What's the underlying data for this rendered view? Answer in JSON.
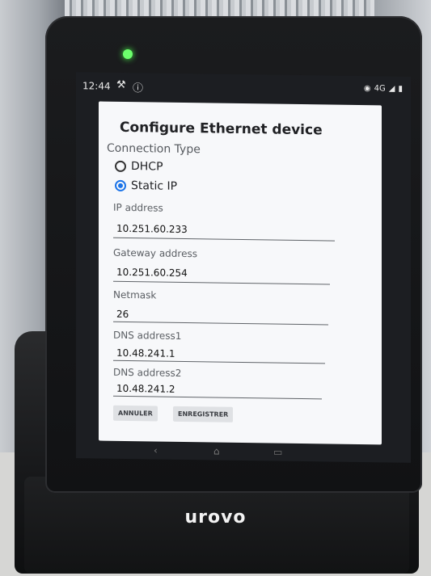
{
  "statusbar": {
    "time": "12:44",
    "network": "4G"
  },
  "dialog": {
    "title": "Configure Ethernet device",
    "connection_type_label": "Connection Type",
    "options": [
      {
        "label": "DHCP",
        "selected": false
      },
      {
        "label": "Static IP",
        "selected": true
      }
    ],
    "fields": [
      {
        "label": "IP address",
        "value": "10.251.60.233"
      },
      {
        "label": "Gateway address",
        "value": "10.251.60.254"
      },
      {
        "label": "Netmask",
        "value": "26"
      },
      {
        "label": "DNS address1",
        "value": "10.48.241.1"
      },
      {
        "label": "DNS address2",
        "value": "10.48.241.2"
      }
    ],
    "cancel_label": "ANNULER",
    "save_label": "ENREGISTRER"
  },
  "navbar": {
    "back_icon": "back-icon",
    "home_icon": "home-icon",
    "recents_icon": "recents-icon"
  },
  "device": {
    "brand": "urovo",
    "led_color": "#6cff6c"
  }
}
